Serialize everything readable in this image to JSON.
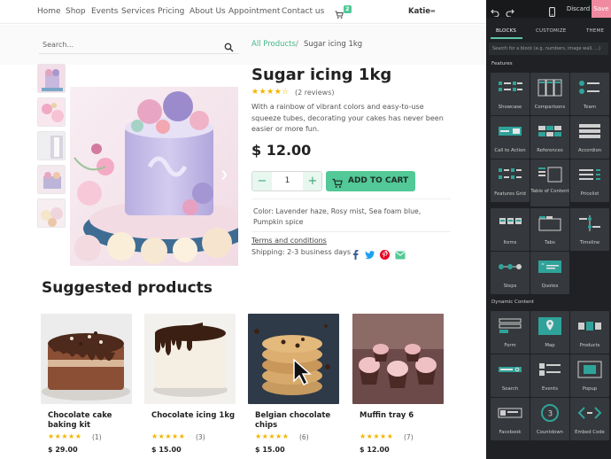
{
  "nav": {
    "items": [
      "Home",
      "Shop",
      "Events",
      "Services",
      "Pricing",
      "About Us",
      "Appointment",
      "Contact us"
    ],
    "cart_count": "2",
    "user": "Katie"
  },
  "search": {
    "placeholder": "Search..."
  },
  "breadcrumb": {
    "parent": "All Products",
    "separator": "/",
    "current": "Sugar icing 1kg"
  },
  "product": {
    "title": "Sugar icing 1kg",
    "stars": "★★★★☆",
    "reviews": "(2 reviews)",
    "description": "With a rainbow of vibrant colors and easy-to-use squeeze tubes, decorating your cakes has never been easier or more fun.",
    "price": "$ 12.00",
    "qty_minus": "−",
    "qty_value": "1",
    "qty_plus": "+",
    "add_to_cart": "ADD TO CART",
    "colors": "Color: Lavender haze, Rosy mist, Sea foam blue, Pumpkin spice",
    "terms": "Terms and conditions",
    "shipping": "Shipping: 2-3 business days"
  },
  "suggested": {
    "title": "Suggested products",
    "items": [
      {
        "name": "Chocolate cake baking kit",
        "stars": "★★★★★",
        "count": "(1)",
        "price": "$ 29.00"
      },
      {
        "name": "Chocolate icing 1kg",
        "stars": "★★★★★",
        "count": "(3)",
        "price": "$ 15.00"
      },
      {
        "name": "Belgian chocolate chips",
        "stars": "★★★★★",
        "count": "(6)",
        "price": "$ 15.00"
      },
      {
        "name": "Muffin tray 6",
        "stars": "★★★★★",
        "count": "(7)",
        "price": "$ 12.00"
      }
    ]
  },
  "editor": {
    "discard": "Discard",
    "save": "Save",
    "tabs": [
      "BLOCKS",
      "CUSTOMIZE",
      "THEME"
    ],
    "search_placeholder": "Search for a block (e.g. numbers, image wall, ...)",
    "features_heading": "Features",
    "features": [
      "Showcase",
      "Comparisons",
      "Team",
      "Call to Action",
      "References",
      "Accordion",
      "Features Grid",
      "Table of Content",
      "Pricelist",
      "Items",
      "Tabs",
      "Timeline",
      "Steps",
      "Quotes"
    ],
    "dynamic_heading": "Dynamic Content",
    "dynamic": [
      "Form",
      "Map",
      "Products",
      "Search",
      "Events",
      "Popup",
      "Facebook",
      "Countdown",
      "Embed Code"
    ]
  },
  "colors": {
    "accent": "#52c996",
    "link": "#45b787",
    "star": "#f4b400",
    "panel_bg": "#1f2124",
    "save": "#f08aa0",
    "teal_icon": "#2fa39a"
  }
}
